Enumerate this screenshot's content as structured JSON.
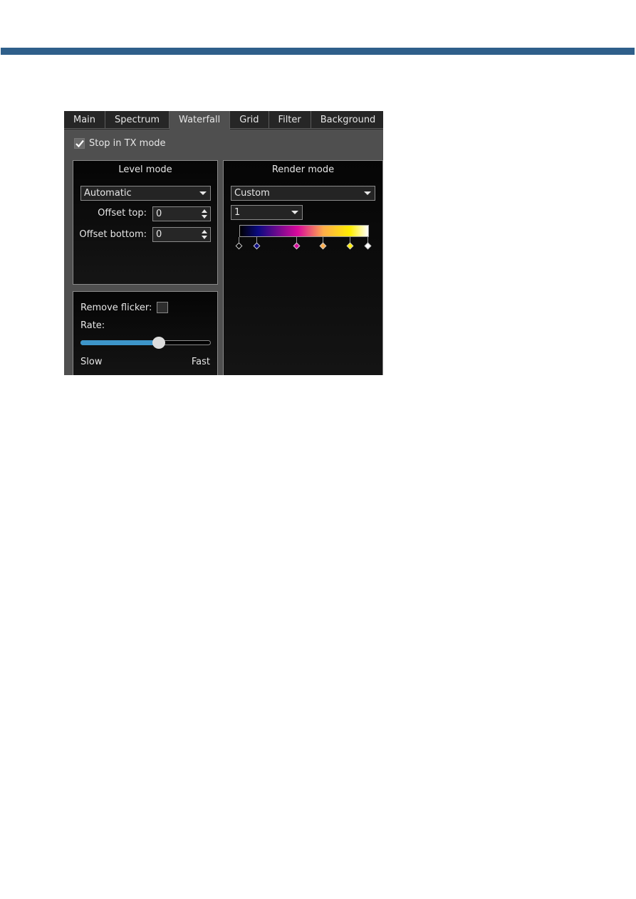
{
  "banner": {
    "color": "#2f5f8a"
  },
  "tabs": [
    {
      "label": "Main",
      "active": false
    },
    {
      "label": "Spectrum",
      "active": false
    },
    {
      "label": "Waterfall",
      "active": true
    },
    {
      "label": "Grid",
      "active": false
    },
    {
      "label": "Filter",
      "active": false
    },
    {
      "label": "Background",
      "active": false
    }
  ],
  "stop_in_tx": {
    "label": "Stop in TX mode",
    "checked": true
  },
  "level_mode": {
    "title": "Level mode",
    "mode_value": "Automatic",
    "offset_top_label": "Offset top:",
    "offset_top_value": "0",
    "offset_bottom_label": "Offset bottom:",
    "offset_bottom_value": "0"
  },
  "flicker": {
    "remove_flicker_label": "Remove flicker:",
    "remove_flicker_checked": false,
    "rate_label": "Rate:",
    "rate_value": 0.6,
    "slow_label": "Slow",
    "fast_label": "Fast",
    "accent_color": "#3d95c9"
  },
  "render_mode": {
    "title": "Render mode",
    "mode_value": "Custom",
    "preset_value": "1",
    "gradient_stops": [
      {
        "position": 0.0,
        "color": "#000000"
      },
      {
        "position": 0.14,
        "color": "#0a0a80"
      },
      {
        "position": 0.45,
        "color": "#d90a9c"
      },
      {
        "position": 0.65,
        "color": "#ffad4a"
      },
      {
        "position": 0.86,
        "color": "#ffee00"
      },
      {
        "position": 1.0,
        "color": "#ffffff"
      }
    ]
  }
}
